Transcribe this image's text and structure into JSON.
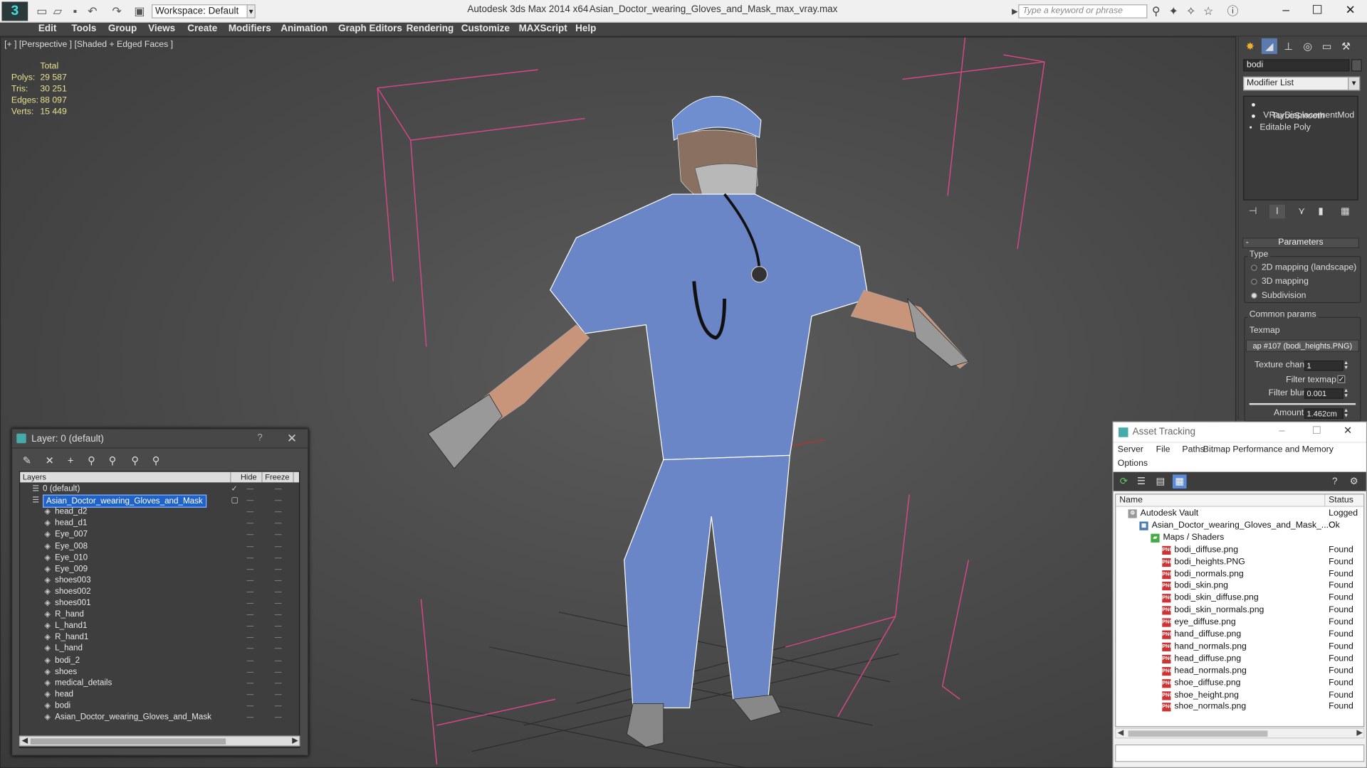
{
  "titlebar": {
    "workspace": "Workspace: Default",
    "app_title": "Autodesk 3ds Max  2014 x64",
    "file_title": "Asian_Doctor_wearing_Gloves_and_Mask_max_vray.max",
    "search_placeholder": "Type a keyword or phrase"
  },
  "menu": [
    "Edit",
    "Tools",
    "Group",
    "Views",
    "Create",
    "Modifiers",
    "Animation",
    "Graph Editors",
    "Rendering",
    "Customize",
    "MAXScript",
    "Help"
  ],
  "viewport": {
    "label": "[+ ] [Perspective ] [Shaded + Edged Faces ]",
    "stats": {
      "header": "Total",
      "rows": [
        {
          "k": "Polys:",
          "v": "29 587"
        },
        {
          "k": "Tris:",
          "v": "30 251"
        },
        {
          "k": "Edges:",
          "v": "88 097"
        },
        {
          "k": "Verts:",
          "v": "15 449"
        }
      ]
    }
  },
  "command_panel": {
    "object_name": "bodi",
    "modifier_list": "Modifier List",
    "stack": [
      "VRayDisplacementMod",
      "TurboSmooth",
      "Editable Poly"
    ],
    "rollout": "Parameters",
    "type_group": "Type",
    "type_options": [
      "2D mapping (landscape)",
      "3D mapping",
      "Subdivision"
    ],
    "type_selected": 2,
    "common_group": "Common params",
    "texmap_label": "Texmap",
    "texmap_value": "ap #107 (bodi_heights.PNG)",
    "texture_chan_label": "Texture chan",
    "texture_chan_value": "1",
    "filter_texmap_label": "Filter texmap",
    "filter_blur_label": "Filter blur",
    "filter_blur_value": "0.001",
    "amount_label": "Amount",
    "amount_value": "1.462cm"
  },
  "layer_window": {
    "title": "Layer: 0 (default)",
    "question": "?",
    "columns": [
      "Layers",
      "Hide",
      "Freeze"
    ],
    "rows": [
      {
        "name": "0 (default)",
        "level": 0,
        "type": "layer"
      },
      {
        "name": "Asian_Doctor_wearing_Gloves_and_Mask",
        "level": 0,
        "type": "layer",
        "selected": true
      },
      {
        "name": "head_d2",
        "level": 1,
        "type": "object"
      },
      {
        "name": "head_d1",
        "level": 1,
        "type": "object"
      },
      {
        "name": "Eye_007",
        "level": 1,
        "type": "object"
      },
      {
        "name": "Eye_008",
        "level": 1,
        "type": "object"
      },
      {
        "name": "Eye_010",
        "level": 1,
        "type": "object"
      },
      {
        "name": "Eye_009",
        "level": 1,
        "type": "object"
      },
      {
        "name": "shoes003",
        "level": 1,
        "type": "object"
      },
      {
        "name": "shoes002",
        "level": 1,
        "type": "object"
      },
      {
        "name": "shoes001",
        "level": 1,
        "type": "object"
      },
      {
        "name": "R_hand",
        "level": 1,
        "type": "object"
      },
      {
        "name": "L_hand1",
        "level": 1,
        "type": "object"
      },
      {
        "name": "R_hand1",
        "level": 1,
        "type": "object"
      },
      {
        "name": "L_hand",
        "level": 1,
        "type": "object"
      },
      {
        "name": "bodi_2",
        "level": 1,
        "type": "object"
      },
      {
        "name": "shoes",
        "level": 1,
        "type": "object"
      },
      {
        "name": "medical_details",
        "level": 1,
        "type": "object"
      },
      {
        "name": "head",
        "level": 1,
        "type": "object"
      },
      {
        "name": "bodi",
        "level": 1,
        "type": "object"
      },
      {
        "name": "Asian_Doctor_wearing_Gloves_and_Mask",
        "level": 1,
        "type": "object"
      }
    ]
  },
  "asset_window": {
    "title": "Asset Tracking",
    "menu": [
      "Server",
      "File",
      "Paths",
      "Bitmap Performance and Memory",
      "Options"
    ],
    "columns": [
      "Name",
      "Status"
    ],
    "rows": [
      {
        "name": "Autodesk Vault",
        "status": "Logged C",
        "level": 0,
        "icon": "vault"
      },
      {
        "name": "Asian_Doctor_wearing_Gloves_and_Mask_...",
        "status": "Ok",
        "level": 1,
        "icon": "max"
      },
      {
        "name": "Maps / Shaders",
        "status": "",
        "level": 2,
        "icon": "maps"
      },
      {
        "name": "bodi_diffuse.png",
        "status": "Found",
        "level": 3,
        "icon": "png"
      },
      {
        "name": "bodi_heights.PNG",
        "status": "Found",
        "level": 3,
        "icon": "png"
      },
      {
        "name": "bodi_normals.png",
        "status": "Found",
        "level": 3,
        "icon": "png"
      },
      {
        "name": "bodi_skin.png",
        "status": "Found",
        "level": 3,
        "icon": "png"
      },
      {
        "name": "bodi_skin_diffuse.png",
        "status": "Found",
        "level": 3,
        "icon": "png"
      },
      {
        "name": "bodi_skin_normals.png",
        "status": "Found",
        "level": 3,
        "icon": "png"
      },
      {
        "name": "eye_diffuse.png",
        "status": "Found",
        "level": 3,
        "icon": "png"
      },
      {
        "name": "hand_diffuse.png",
        "status": "Found",
        "level": 3,
        "icon": "png"
      },
      {
        "name": "hand_normals.png",
        "status": "Found",
        "level": 3,
        "icon": "png"
      },
      {
        "name": "head_diffuse.png",
        "status": "Found",
        "level": 3,
        "icon": "png"
      },
      {
        "name": "head_normals.png",
        "status": "Found",
        "level": 3,
        "icon": "png"
      },
      {
        "name": "shoe_diffuse.png",
        "status": "Found",
        "level": 3,
        "icon": "png"
      },
      {
        "name": "shoe_height.png",
        "status": "Found",
        "level": 3,
        "icon": "png"
      },
      {
        "name": "shoe_normals.png",
        "status": "Found",
        "level": 3,
        "icon": "png"
      }
    ]
  }
}
